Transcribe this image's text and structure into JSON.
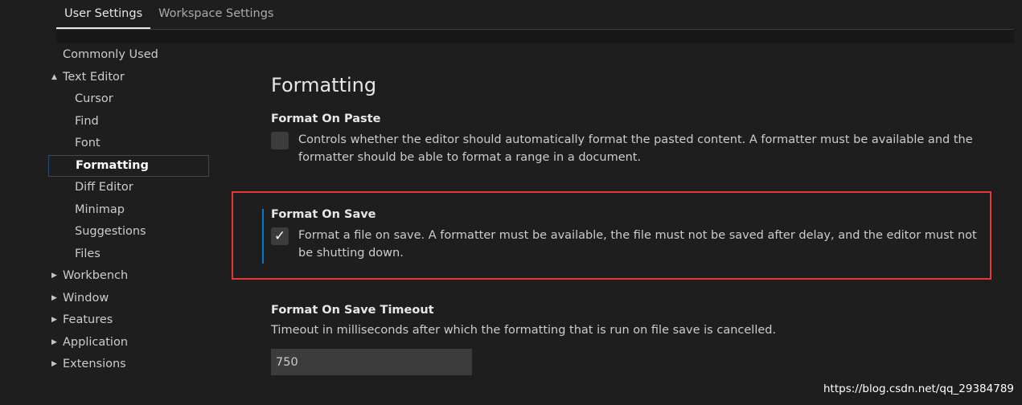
{
  "tabs": [
    {
      "label": "User Settings",
      "active": true
    },
    {
      "label": "Workspace Settings",
      "active": false
    }
  ],
  "tree": {
    "items": [
      {
        "label": "Commonly Used"
      },
      {
        "label": "Text Editor",
        "caret": "▲"
      },
      {
        "label": "Cursor"
      },
      {
        "label": "Find"
      },
      {
        "label": "Font"
      },
      {
        "label": "Formatting"
      },
      {
        "label": "Diff Editor"
      },
      {
        "label": "Minimap"
      },
      {
        "label": "Suggestions"
      },
      {
        "label": "Files"
      },
      {
        "label": "Workbench",
        "caret": "▶"
      },
      {
        "label": "Window",
        "caret": "▶"
      },
      {
        "label": "Features",
        "caret": "▶"
      },
      {
        "label": "Application",
        "caret": "▶"
      },
      {
        "label": "Extensions",
        "caret": "▶"
      }
    ]
  },
  "section": {
    "title": "Formatting"
  },
  "settings": {
    "format_on_paste": {
      "title": "Format On Paste",
      "description": "Controls whether the editor should automatically format the pasted content. A formatter must be available and the formatter should be able to format a range in a document.",
      "checked": false
    },
    "format_on_save": {
      "title": "Format On Save",
      "description": "Format a file on save. A formatter must be available, the file must not be saved after delay, and the editor must not be shutting down.",
      "checked": true,
      "check_glyph": "✓"
    },
    "format_on_save_timeout": {
      "title": "Format On Save Timeout",
      "description": "Timeout in milliseconds after which the formatting that is run on file save is cancelled.",
      "value": "750"
    }
  },
  "watermark": "https://blog.csdn.net/qq_29384789",
  "colors": {
    "background": "#1e1e1e",
    "highlight_box": "#e53935",
    "focus_bar": "#007acc",
    "selection_border": "#264f78"
  }
}
